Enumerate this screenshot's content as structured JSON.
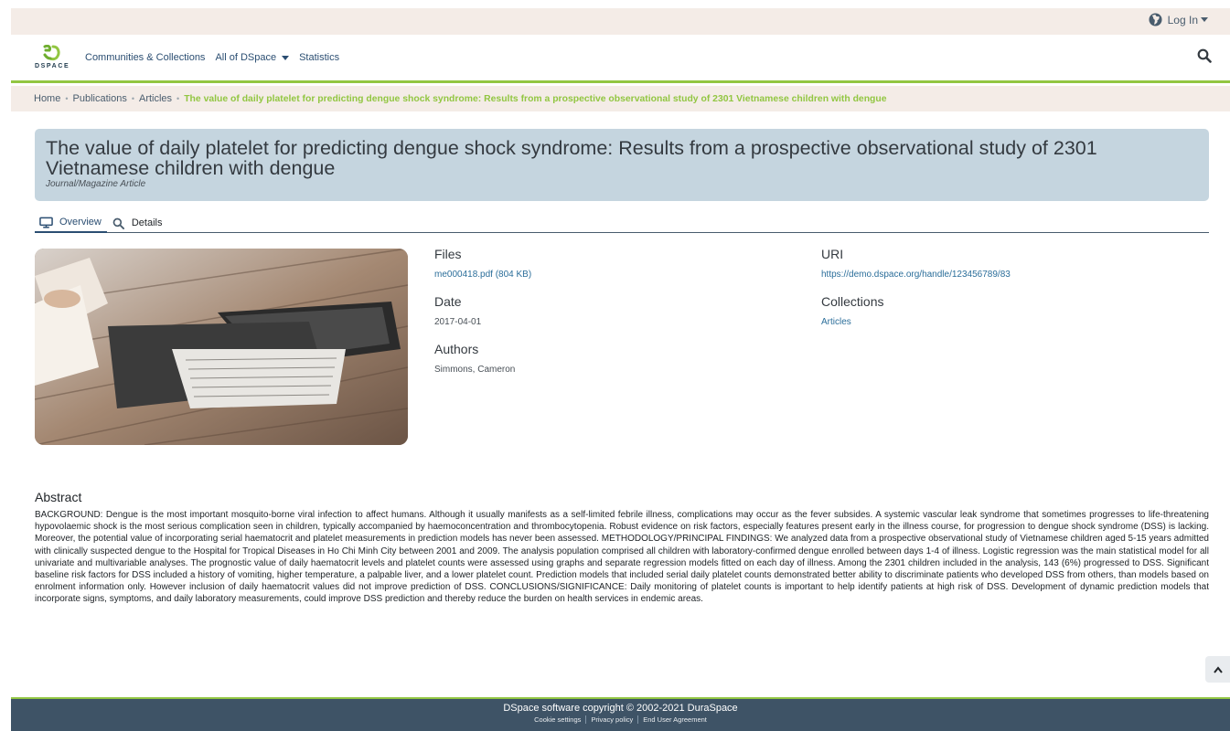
{
  "topbar": {
    "login_label": "Log In"
  },
  "navbar": {
    "logo_text": "DSPACE",
    "links": [
      "Communities & Collections",
      "All of DSpace",
      "Statistics"
    ]
  },
  "breadcrumb": {
    "items": [
      "Home",
      "Publications",
      "Articles"
    ],
    "current": "The value of daily platelet for predicting dengue shock syndrome: Results from a prospective observational study of 2301 Vietnamese children with dengue"
  },
  "item": {
    "title": "The value of daily platelet for predicting dengue shock syndrome: Results from a prospective observational study of 2301 Vietnamese children with dengue",
    "type": "Journal/Magazine Article"
  },
  "tabs": [
    {
      "label": "Overview",
      "icon": "monitor-icon",
      "active": true
    },
    {
      "label": "Details",
      "icon": "search-icon",
      "active": false
    }
  ],
  "metadata": {
    "files": {
      "label": "Files",
      "value": "me000418.pdf (804 KB)"
    },
    "date": {
      "label": "Date",
      "value": "2017-04-01"
    },
    "authors": {
      "label": "Authors",
      "value": "Simmons, Cameron"
    },
    "uri": {
      "label": "URI",
      "value": "https://demo.dspace.org/handle/123456789/83"
    },
    "collections": {
      "label": "Collections",
      "value": "Articles"
    }
  },
  "abstract": {
    "heading": "Abstract",
    "text": "BACKGROUND: Dengue is the most important mosquito-borne viral infection to affect humans. Although it usually manifests as a self-limited febrile illness, complications may occur as the fever subsides. A systemic vascular leak syndrome that sometimes progresses to life-threatening hypovolaemic shock is the most serious complication seen in children, typically accompanied by haemoconcentration and thrombocytopenia. Robust evidence on risk factors, especially features present early in the illness course, for progression to dengue shock syndrome (DSS) is lacking. Moreover, the potential value of incorporating serial haematocrit and platelet measurements in prediction models has never been assessed. METHODOLOGY/PRINCIPAL FINDINGS: We analyzed data from a prospective observational study of Vietnamese children aged 5-15 years admitted with clinically suspected dengue to the Hospital for Tropical Diseases in Ho Chi Minh City between 2001 and 2009. The analysis population comprised all children with laboratory-confirmed dengue enrolled between days 1-4 of illness. Logistic regression was the main statistical model for all univariate and multivariable analyses. The prognostic value of daily haematocrit levels and platelet counts were assessed using graphs and separate regression models fitted on each day of illness. Among the 2301 children included in the analysis, 143 (6%) progressed to DSS. Significant baseline risk factors for DSS included a history of vomiting, higher temperature, a palpable liver, and a lower platelet count. Prediction models that included serial daily platelet counts demonstrated better ability to discriminate patients who developed DSS from others, than models based on enrolment information only. However inclusion of daily haematocrit values did not improve prediction of DSS. CONCLUSIONS/SIGNIFICANCE: Daily monitoring of platelet counts is important to help identify patients at high risk of DSS. Development of dynamic prediction models that incorporate signs, symptoms, and daily laboratory measurements, could improve DSS prediction and thereby reduce the burden on health services in endemic areas."
  },
  "footer": {
    "copyright": "DSpace software copyright © 2002-2021 DuraSpace",
    "links": [
      "Cookie settings",
      "Privacy policy",
      "End User Agreement"
    ]
  },
  "colors": {
    "accent": "#92c642",
    "header_bg": "#c5d5df",
    "footer_bg": "#3e5366",
    "link": "#2b6e9a"
  }
}
